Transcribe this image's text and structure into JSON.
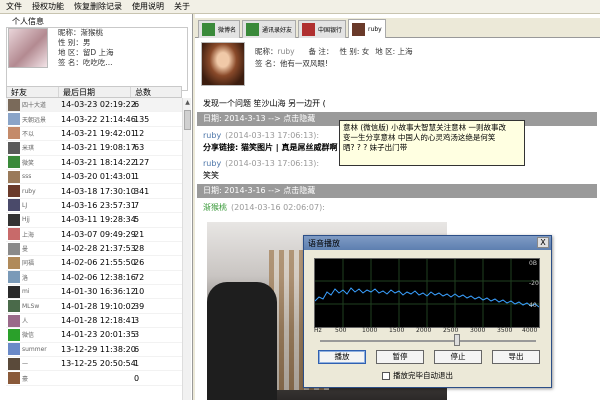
{
  "menu": [
    "文件",
    "授权功能",
    "恢复删除记录",
    "使用说明",
    "关于"
  ],
  "profile_section": {
    "title": "个人信息",
    "nickname": "昵称：渐猴桃",
    "gender": "性 别：男",
    "region": "地 区：留D 上海",
    "signature": "签 名：吃吃吃..."
  },
  "friends_table": {
    "headers": [
      "好友",
      "最后日期",
      "总数"
    ],
    "rows": [
      {
        "name": "四十大道",
        "date": "14-03-23 02:19:22",
        "count": "6",
        "color": "#7a6a5a"
      },
      {
        "name": "天朝远景",
        "date": "14-03-22 21:14:46",
        "count": "135",
        "color": "#8aa4c8"
      },
      {
        "name": "不以",
        "date": "14-03-21 19:42:01",
        "count": "12",
        "color": "#c48a6a"
      },
      {
        "name": "米琪",
        "date": "14-03-21 19:08:17",
        "count": "63",
        "color": "#5a5a5a"
      },
      {
        "name": "微笑",
        "date": "14-03-21 18:14:22",
        "count": "127",
        "color": "#3a8a3a"
      },
      {
        "name": "sss",
        "date": "14-03-20 01:43:01",
        "count": "1",
        "color": "#9a7a5a"
      },
      {
        "name": "ruby",
        "date": "14-03-18 17:30:10",
        "count": "341",
        "color": "#6a3a2a"
      },
      {
        "name": "LJ",
        "date": "14-03-16 23:57:31",
        "count": "7",
        "color": "#4a4a6a"
      },
      {
        "name": "Hjj",
        "date": "14-03-11 19:28:34",
        "count": "5",
        "color": "#333333"
      },
      {
        "name": "上海",
        "date": "14-03-07 09:49:29",
        "count": "21",
        "color": "#c86a6a"
      },
      {
        "name": "曼",
        "date": "14-02-28 21:37:53",
        "count": "28",
        "color": "#8a8a8a"
      },
      {
        "name": "同福",
        "date": "14-02-06 21:55:50",
        "count": "26",
        "color": "#b08a5a"
      },
      {
        "name": "洛",
        "date": "14-02-06 12:38:16",
        "count": "72",
        "color": "#7a9ab8"
      },
      {
        "name": "mi",
        "date": "14-01-30 16:36:12",
        "count": "10",
        "color": "#2a2a2a"
      },
      {
        "name": "MLSw",
        "date": "14-01-28 19:10:02",
        "count": "39",
        "color": "#4a6a4a"
      },
      {
        "name": "人",
        "date": "14-01-28 12:18:41",
        "count": "3",
        "color": "#9a6a8a"
      },
      {
        "name": "微信",
        "date": "14-01-23 20:01:35",
        "count": "3",
        "color": "#2aa02a"
      },
      {
        "name": "summer",
        "date": "13-12-29 11:38:20",
        "count": "6",
        "color": "#6a8ac8"
      },
      {
        "name": "一",
        "date": "13-12-25 20:50:54",
        "count": "1",
        "color": "#5a4a3a"
      },
      {
        "name": "豪",
        "date": "",
        "count": "0",
        "color": "#8a5a3a"
      }
    ]
  },
  "tabs": [
    {
      "label": "微博名",
      "icon_color": "#3a8a3a"
    },
    {
      "label": "通讯录好友",
      "icon_color": "#3a8a3a"
    },
    {
      "label": "中国银行",
      "icon_color": "#b03030"
    },
    {
      "label": "ruby",
      "icon_color": "#6a3a2a",
      "active": true
    }
  ],
  "contact": {
    "nickname": "昵称：",
    "account": "ruby",
    "remark": "备 注：",
    "gender": "性 别: 女",
    "region": "地 区: 上海",
    "signature": "签 名：他有一双风眼!"
  },
  "chat": {
    "line1": "发现一个问题 笙沙山海 另一边开 (",
    "date1": "日期: 2014-3-13  --> 点击隐藏",
    "msg1_sender": "ruby",
    "msg1_time": "(2014-03-13 17:06:13):",
    "msg1_text": "分享链接: 猫笑图片 | 真是屌丝威群啊",
    "msg2_sender": "ruby",
    "msg2_time": "(2014-03-13 17:06:13):",
    "msg2_text": "笑笑",
    "date2": "日期: 2014-3-16  --> 点击隐藏",
    "msg3_sender": "渐猴桃",
    "msg3_time": "(2014-03-16 02:06:07):"
  },
  "tooltip": {
    "line1": "意林 (微信版)  小故事大智慧关注意林  一则故事改",
    "line2": "变一生分享意林  中国人的心灵鸡汤这绝是何笑",
    "line3": "晒? ? ? 妹子出门带"
  },
  "voice_dialog": {
    "title": "语音播放",
    "close": "X",
    "freq_labels": [
      "Hz",
      "500",
      "1000",
      "1500",
      "2000",
      "2500",
      "3000",
      "3500",
      "4000"
    ],
    "db_labels": [
      "0B",
      "-20",
      "40"
    ],
    "buttons": [
      "播放",
      "暂停",
      "停止",
      "导出"
    ],
    "auto_exit": "播放完毕自动退出"
  }
}
